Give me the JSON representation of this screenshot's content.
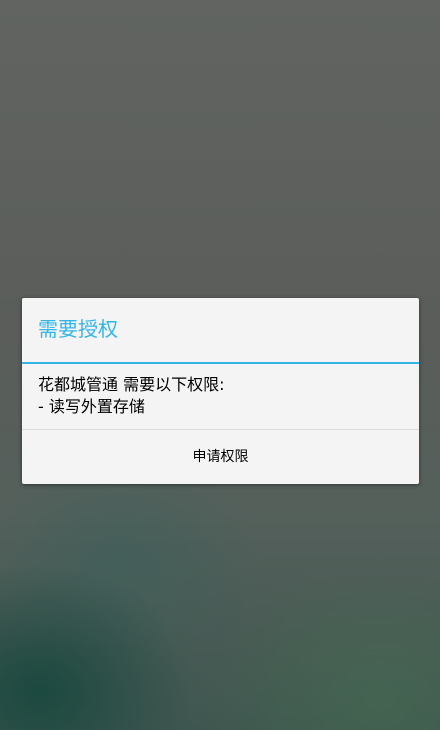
{
  "dialog": {
    "title": "需要授权",
    "message_lines": [
      "花都城管通 需要以下权限:",
      "- 读写外置存储"
    ],
    "button_label": "申请权限",
    "accent_color": "#33b5e5"
  }
}
